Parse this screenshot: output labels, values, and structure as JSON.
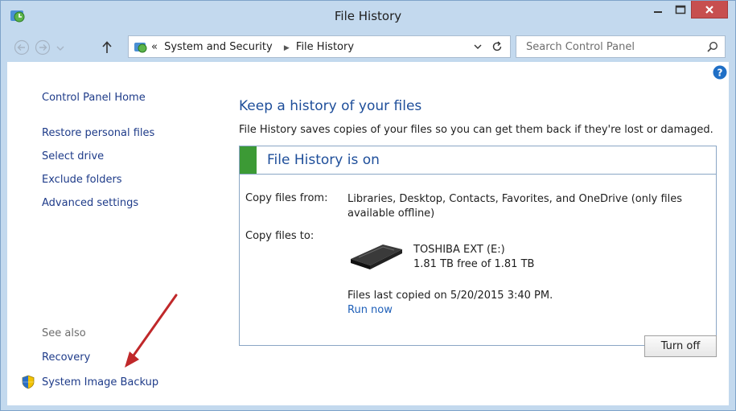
{
  "window": {
    "title": "File History"
  },
  "nav": {
    "breadcrumb_prefix": "«",
    "crumbs": [
      "System and Security",
      "File History"
    ],
    "search_placeholder": "Search Control Panel"
  },
  "sidebar": {
    "home": "Control Panel Home",
    "items": [
      "Restore personal files",
      "Select drive",
      "Exclude folders",
      "Advanced settings"
    ],
    "see_also_label": "See also",
    "see_also": [
      "Recovery",
      "System Image Backup"
    ]
  },
  "main": {
    "heading": "Keep a history of your files",
    "description": "File History saves copies of your files so you can get them back if they're lost or damaged.",
    "status": "File History is on",
    "copy_from_label": "Copy files from:",
    "copy_from_value": "Libraries, Desktop, Contacts, Favorites, and OneDrive (only files available offline)",
    "copy_to_label": "Copy files to:",
    "drive_name": "TOSHIBA EXT (E:)",
    "drive_free": "1.81 TB free of 1.81 TB",
    "last_copied": "Files last copied on 5/20/2015 3:40 PM.",
    "run_now": "Run now",
    "turn_off": "Turn off"
  },
  "colors": {
    "title_bar": "#c3d9ee",
    "link": "#1e3b89",
    "heading": "#1e4e9a",
    "status_on": "#3c9a35",
    "close_button": "#c74f4f",
    "annotation_arrow": "#c0282a"
  },
  "icons": {
    "app": "file-history-icon",
    "back": "back-arrow-icon",
    "forward": "forward-arrow-icon",
    "up": "up-arrow-icon",
    "refresh": "refresh-icon",
    "search": "search-icon",
    "help": "help-icon",
    "drive": "external-drive-icon",
    "shield": "uac-shield-icon"
  }
}
